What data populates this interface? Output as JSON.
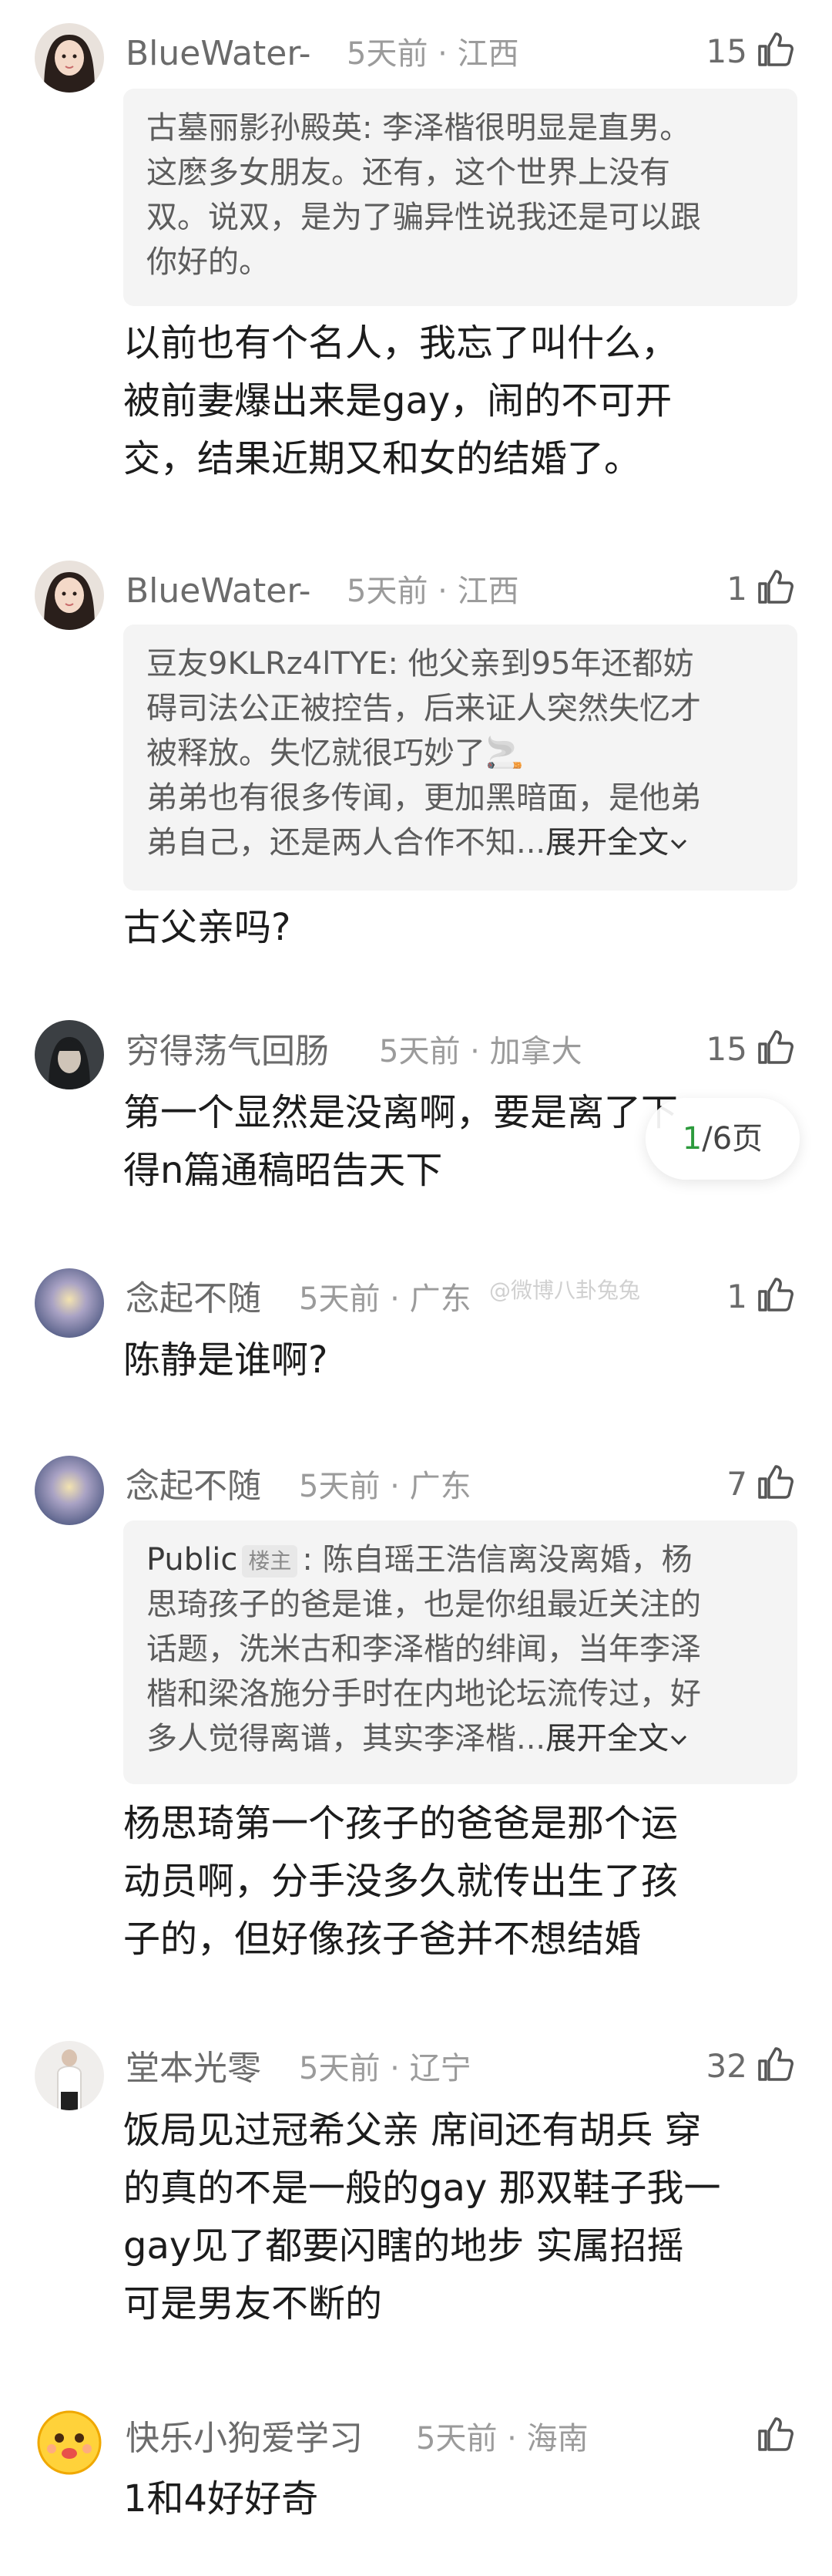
{
  "comments": [
    {
      "username": "BlueWater-",
      "meta": "5天前 · 江西",
      "likes": "15",
      "quote": {
        "author": "古墓丽影孙殿英",
        "lines": [
          "古墓丽影孙殿英: 李泽楷很明显是直男。",
          "这麽多女朋友。还有，这个世界上没有",
          "双。说双，是为了骗异性说我还是可以跟",
          "你好的。"
        ]
      },
      "body_lines": [
        "以前也有个名人，我忘了叫什么，",
        "被前妻爆出来是gay，闹的不可开",
        "交，结果近期又和女的结婚了。"
      ]
    },
    {
      "username": "BlueWater-",
      "meta": "5天前 · 江西",
      "likes": "1",
      "quote": {
        "lines": [
          "豆友9KLRz4lTYE: 他父亲到95年还都妨",
          "碍司法公正被控告，后来证人突然失忆才",
          "被释放。失忆就很巧妙了🚬",
          "弟弟也有很多传闻，更加黑暗面，是他弟",
          "弟自己，还是两人合作不知..."
        ],
        "expand": "展开全文"
      },
      "body_lines": [
        "古父亲吗?"
      ]
    },
    {
      "username": "穷得荡气回肠",
      "meta": "5天前 · 加拿大",
      "likes": "15",
      "body_lines": [
        "第一个显然是没离啊，要是离了下",
        "得n篇通稿昭告天下"
      ]
    },
    {
      "username": "念起不随",
      "meta": "5天前 · 广东",
      "likes": "1",
      "body_lines": [
        "陈静是谁啊?"
      ]
    },
    {
      "username": "念起不随",
      "meta": "5天前 · 广东",
      "likes": "7",
      "quote": {
        "author": "Public",
        "badge": "楼主",
        "first_rest": ": 陈自瑶王浩信离没离婚，杨",
        "lines": [
          "思琦孩子的爸是谁，也是你组最近关注的",
          "话题，洗米古和李泽楷的绯闻，当年李泽",
          "楷和梁洛施分手时在内地论坛流传过，好",
          "多人觉得离谱，其实李泽楷..."
        ],
        "expand": "展开全文"
      },
      "body_lines": [
        "杨思琦第一个孩子的爸爸是那个运",
        "动员啊，分手没多久就传出生了孩",
        "子的，但好像孩子爸并不想结婚"
      ]
    },
    {
      "username": "堂本光零",
      "meta": "5天前 · 辽宁",
      "likes": "32",
      "body_lines": [
        "饭局见过冠希父亲 席间还有胡兵 穿",
        "的真的不是一般的gay 那双鞋子我一",
        "gay见了都要闪瞎的地步 实属招摇",
        "可是男友不断的"
      ]
    },
    {
      "username": "快乐小狗爱学习",
      "meta": "5天前 · 海南",
      "likes": "",
      "body_lines": [
        "1和4好好奇"
      ]
    }
  ],
  "pager": {
    "current": "1",
    "rest": "/6页"
  },
  "watermark": "@微博八卦兔兔",
  "icons": {
    "like": "thumbs-up-icon",
    "expand": "chevron-down-icon"
  }
}
